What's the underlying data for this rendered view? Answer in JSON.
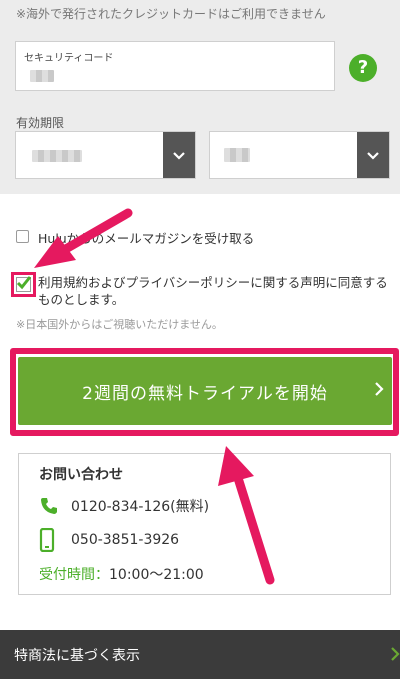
{
  "form": {
    "notice_top": "※海外で発行されたクレジットカードはご利用できません",
    "security_code_label": "セキュリティコード",
    "expiry_label": "有効期限",
    "help_symbol": "?"
  },
  "options": {
    "newsletter_label": "Huluからのメールマガジンを受け取る",
    "newsletter_checked": false,
    "terms_label": "利用規約およびプライバシーポリシーに関する声明に同意するものとします。",
    "terms_checked": true,
    "region_notice": "※日本国外からはご視聴いただけません。"
  },
  "cta": {
    "label": "2週間の無料トライアルを開始"
  },
  "contact": {
    "title": "お問い合わせ",
    "phone_free": "0120-834-126(無料)",
    "phone_mobile": "050-3851-3926",
    "hours_label": "受付時間：",
    "hours_value": "10:00〜21:00"
  },
  "footer": {
    "label": "特商法に基づく表示"
  },
  "colors": {
    "accent_green": "#6aa832",
    "highlight_pink": "#e5195f",
    "footer_bg": "#3b3b3b"
  }
}
